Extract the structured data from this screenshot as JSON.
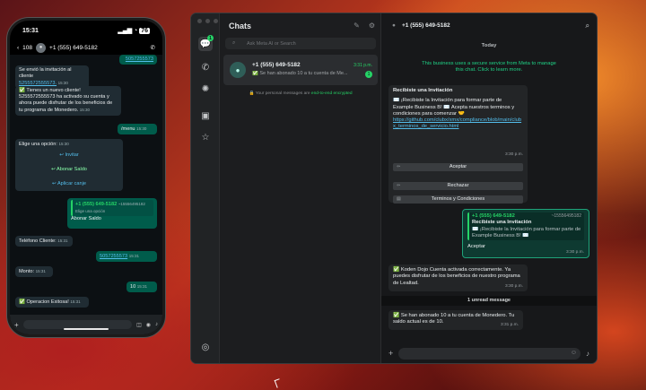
{
  "phone": {
    "time": "15:31",
    "battery": "76",
    "back_count": "108",
    "contact": "+1 (555) 649-5182",
    "messages": [
      {
        "text": "5057255573",
        "time": "",
        "dir": "out"
      },
      {
        "text": "Se envió la invitación al cliente",
        "link": "5255572555573.",
        "time": "15:30",
        "dir": "in"
      },
      {
        "text": "✅ Tienes un nuevo cliente! 5255572555573 ha activado su cuenta y ahora puede disfrutar de los beneficios de tu programa de Monedero.",
        "time": "15:30",
        "dir": "in"
      },
      {
        "text": "/menu",
        "time": "15:30",
        "dir": "out"
      },
      {
        "text": "Elige una opción:",
        "time": "15:30",
        "dir": "in"
      },
      {
        "text": "Invitar",
        "dir": "opt"
      },
      {
        "text": "Abonar Saldo",
        "dir": "opt"
      },
      {
        "text": "Aplicar canje",
        "dir": "opt"
      },
      {
        "text": "Elige una opción",
        "quote_name": "+1 (555) 649-5182",
        "quote_num": "~15556495182",
        "reply": "Abonar Saldo",
        "dir": "out"
      },
      {
        "text": "Teléfono Cliente:",
        "time": "15:31",
        "dir": "in"
      },
      {
        "text": "5057255573",
        "time": "15:31",
        "dir": "out"
      },
      {
        "text": "Monto:",
        "time": "15:31",
        "dir": "in"
      },
      {
        "text": "10",
        "time": "15:31",
        "dir": "out"
      },
      {
        "text": "✅ Operacion Exitosa!",
        "time": "15:31",
        "dir": "in"
      }
    ]
  },
  "window": {
    "list_title": "Chats",
    "search_placeholder": "Ask Meta AI or Search",
    "rail_badge": "1",
    "chat": {
      "name": "+1 (555) 649-5182",
      "time": "3:31 p.m.",
      "preview": "✅ Se han abonado 10 a tu cuenta de Me...",
      "unread": "1"
    },
    "encryption": {
      "text": "Your personal messages are",
      "bold": "end-to-end encrypted"
    }
  },
  "conversation": {
    "header_name": "+1 (555) 649-5182",
    "date": "Today",
    "system": "This business uses a secure service from Meta to manage this chat. Click to learn more.",
    "invite": {
      "title": "Recibiste una Invitación",
      "body": "✉️ ¡Recibiste la Invitación para formar parte de Example Business B! ✉️ Acepta nuestros terminos y condiciones para comenzar 🤝",
      "link": "https://github.com/clubx/xmx/compliance/blob/main/clubx_terminos_de_servicio.html",
      "time": "3:30 p.m.",
      "buttons": [
        "Aceptar",
        "Rechazar",
        "Terminos y Condiciones"
      ]
    },
    "reply": {
      "quote_name": "+1 (555) 649-5182",
      "quote_num": "~15556495182",
      "quote_title": "Recibiste una Invitación",
      "quote_body": "✉️ ¡Recibiste la Invitación para formar parte de Example Business B! ✉️",
      "text": "Aceptar",
      "time": "3:30 p.m."
    },
    "activated": {
      "text": "✅ Koden Dojo Cuenta activada correctamente. Ya puedes disfrutar de los beneficios de nuestro programa de Lealtad.",
      "time": "3:30 p.m."
    },
    "unread_label": "1 unread message",
    "credit": {
      "text": "✅ Se han abonado 10 a tu cuenta de Monedero. Tu saldo actual es de 10.",
      "time": "3:31 p.m."
    }
  },
  "colors": {
    "accent": "#25d366",
    "outgoing": "#005c4b",
    "incoming": "#202c33"
  }
}
